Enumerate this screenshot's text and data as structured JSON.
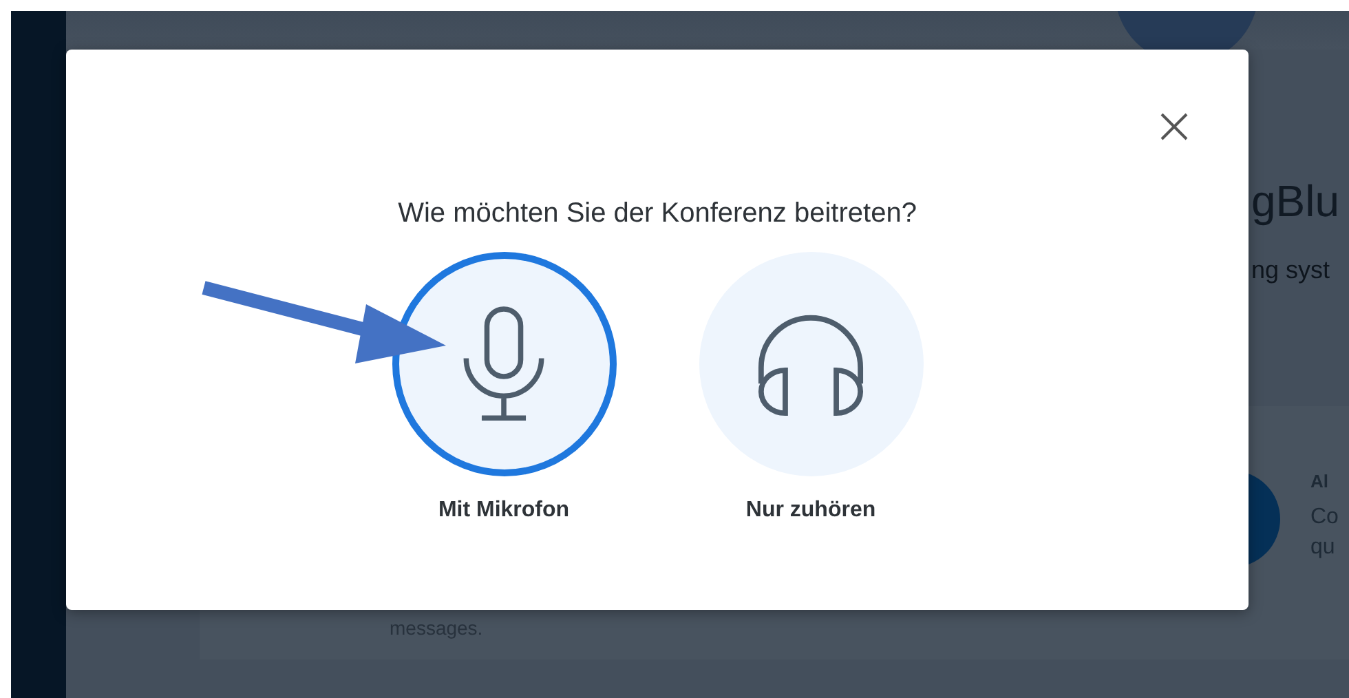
{
  "background": {
    "title": "gBlu",
    "subtitle": "ng syst",
    "card_heading": "Al",
    "card_lines": [
      "Co",
      "qu"
    ],
    "message_text": "messages."
  },
  "dialog": {
    "title": "Wie möchten Sie der Konferenz beitreten?",
    "options": [
      {
        "kind": "microphone",
        "label": "Mit Mikrofon",
        "selected": true
      },
      {
        "kind": "headphones",
        "label": "Nur zuhören",
        "selected": false
      }
    ]
  },
  "annotation": {
    "kind": "arrow"
  }
}
